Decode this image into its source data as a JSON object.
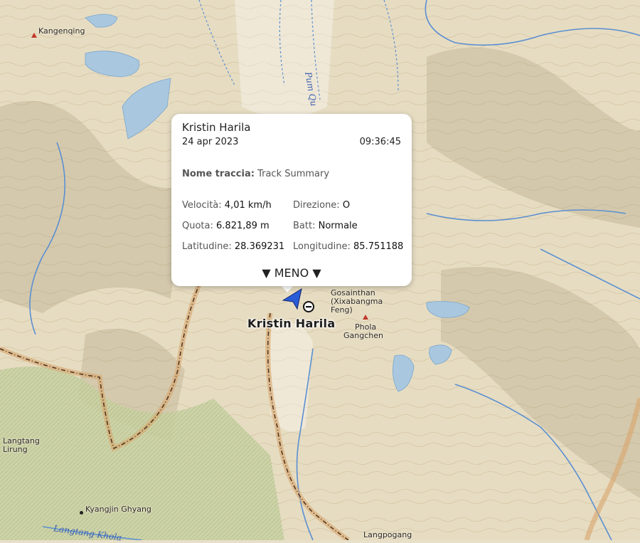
{
  "map": {
    "labels": {
      "kangenqing": "Kangenqing",
      "langtang_lirung_1": "Langtang",
      "langtang_lirung_2": "Lirung",
      "kyangjin": "Kyangjin Ghyang",
      "gosainthan_1": "Gosainthan",
      "gosainthan_2": "(Xixabangma",
      "gosainthan_3": "Feng)",
      "phola_1": "Phola",
      "phola_2": "Gangchen",
      "bottom_village": "Langpogang",
      "river_pum": "Pum Qu",
      "river_langtang": "Langtang Khola"
    },
    "colors": {
      "terrain": "#e6dcc2",
      "forest": "#c7cf9f",
      "water": "#a9c8e0",
      "river": "#5b8fd1",
      "trail": "#5a3a1a",
      "border": "#d9a56a"
    }
  },
  "tracker": {
    "name": "Kristin Harila",
    "icon": "arrow-navigation-icon"
  },
  "popup": {
    "title": "Kristin Harila",
    "date": "24 apr 2023",
    "time": "09:36:45",
    "track_label": "Nome traccia:",
    "track_value": "Track Summary",
    "speed_label": "Velocità:",
    "speed_value": "4,01 km/h",
    "direction_label": "Direzione:",
    "direction_value": "O",
    "altitude_label": "Quota:",
    "altitude_value": "6.821,89 m",
    "battery_label": "Batt:",
    "battery_value": "Normale",
    "lat_label": "Latitudine:",
    "lat_value": "28.369231",
    "lon_label": "Longitudine:",
    "lon_value": "85.751188",
    "menu_label": "▼ MENO ▼"
  }
}
